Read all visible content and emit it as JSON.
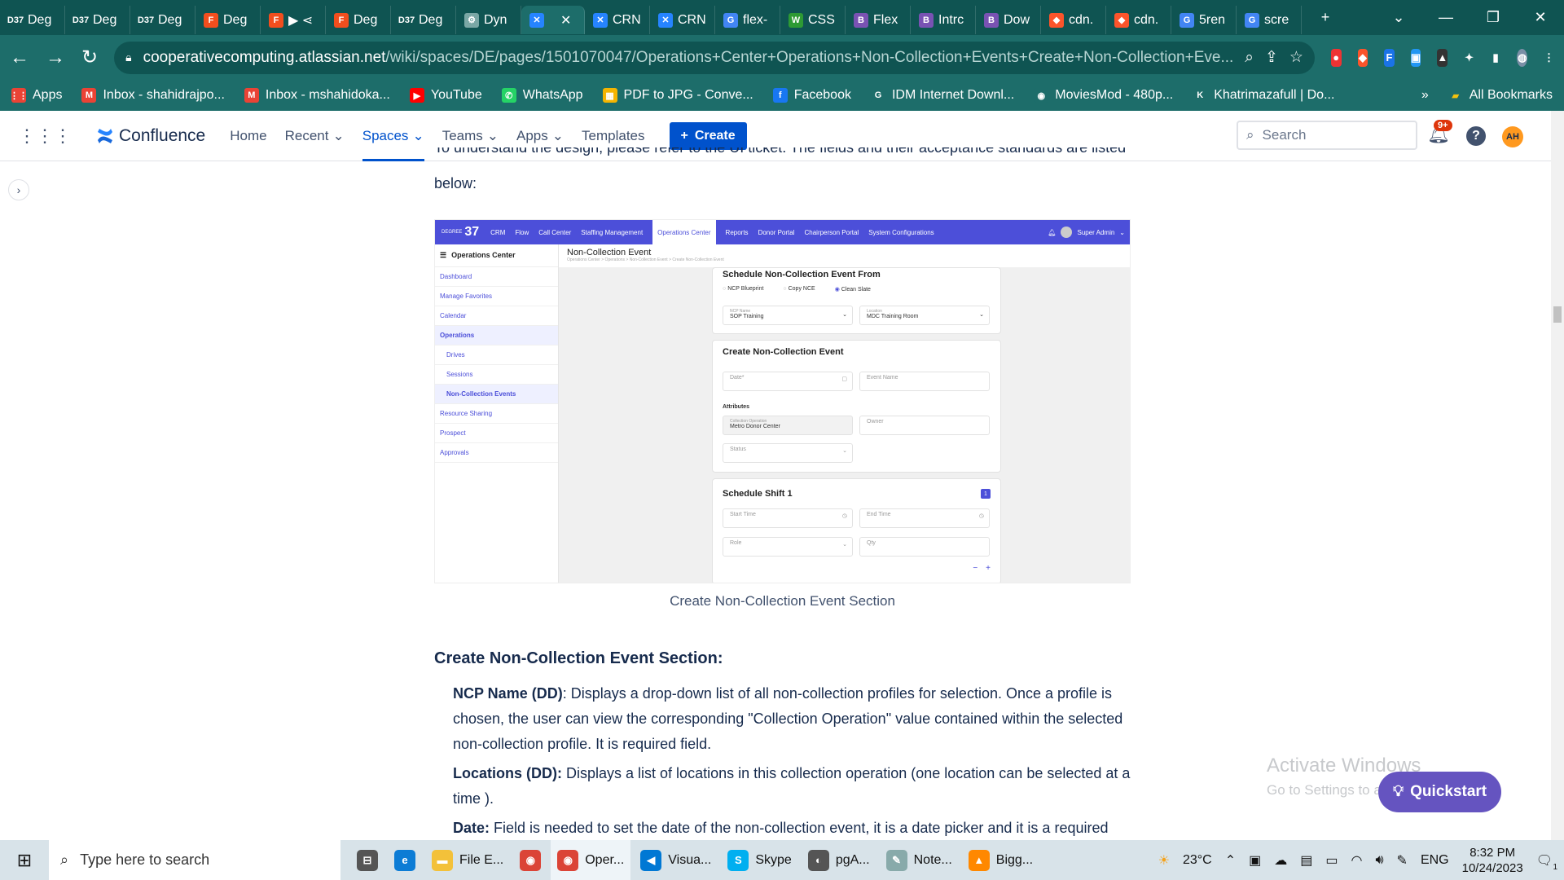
{
  "browser": {
    "tabs": [
      {
        "label": "Deg",
        "icon": "D37",
        "color": "#0f5452"
      },
      {
        "label": "Deg",
        "icon": "D37",
        "color": "#0f5452"
      },
      {
        "label": "Deg",
        "icon": "D37",
        "color": "#0f5452"
      },
      {
        "label": "Deg",
        "icon": "F",
        "color": "#f24e1e"
      },
      {
        "label": "▶ ⋖",
        "icon": "F",
        "color": "#f24e1e"
      },
      {
        "label": "Deg",
        "icon": "F",
        "color": "#f24e1e"
      },
      {
        "label": "Deg",
        "icon": "D37",
        "color": "#0f5452"
      },
      {
        "label": "Dyn",
        "icon": "⚙",
        "color": "#7aa7a5"
      },
      {
        "label": "✕",
        "icon": "✕",
        "color": "#2684ff",
        "active": true
      },
      {
        "label": "CRN",
        "icon": "✕",
        "color": "#2684ff"
      },
      {
        "label": "CRN",
        "icon": "✕",
        "color": "#2684ff"
      },
      {
        "label": "flex-",
        "icon": "G",
        "color": "#4285f4"
      },
      {
        "label": "CSS",
        "icon": "W",
        "color": "#2d9a34"
      },
      {
        "label": "Flex",
        "icon": "B",
        "color": "#7952b3"
      },
      {
        "label": "Intrc",
        "icon": "B",
        "color": "#7952b3"
      },
      {
        "label": "Dow",
        "icon": "B",
        "color": "#7952b3"
      },
      {
        "label": "cdn.",
        "icon": "◆",
        "color": "#fb542b"
      },
      {
        "label": "cdn.",
        "icon": "◆",
        "color": "#fb542b"
      },
      {
        "label": "5ren",
        "icon": "G",
        "color": "#4285f4"
      },
      {
        "label": "scre",
        "icon": "G",
        "color": "#4285f4"
      }
    ],
    "url_host": "cooperativecomputing.atlassian.net",
    "url_path": "/wiki/spaces/DE/pages/1501070047/Operations+Center+Operations+Non-Collection+Events+Create+Non-Collection+Eve...",
    "bookmarks": [
      {
        "label": "Apps",
        "icon": "⋮⋮",
        "color": "#ea4335"
      },
      {
        "label": "Inbox - shahidrajpo...",
        "icon": "M",
        "color": "#ea4335"
      },
      {
        "label": "Inbox - mshahidoka...",
        "icon": "M",
        "color": "#ea4335"
      },
      {
        "label": "YouTube",
        "icon": "▶",
        "color": "#ff0000"
      },
      {
        "label": "WhatsApp",
        "icon": "✆",
        "color": "#25d366"
      },
      {
        "label": "PDF to JPG - Conve...",
        "icon": "▦",
        "color": "#f4b400"
      },
      {
        "label": "Facebook",
        "icon": "f",
        "color": "#1877f2"
      },
      {
        "label": "IDM Internet Downl...",
        "icon": "G",
        "color": "#1d6d6a"
      },
      {
        "label": "MoviesMod - 480p...",
        "icon": "◉",
        "color": "#1d6d6a"
      },
      {
        "label": "Khatrimazafull | Do...",
        "icon": "K",
        "color": "#1d6d6a"
      }
    ],
    "bookmarks_more": "»",
    "all_bookmarks": "All Bookmarks"
  },
  "confluence": {
    "brand": "Confluence",
    "nav": [
      {
        "label": "Home",
        "dropdown": false
      },
      {
        "label": "Recent",
        "dropdown": true
      },
      {
        "label": "Spaces",
        "dropdown": true,
        "selected": true
      },
      {
        "label": "Teams",
        "dropdown": true
      },
      {
        "label": "Apps",
        "dropdown": true
      },
      {
        "label": "Templates",
        "dropdown": false
      }
    ],
    "create_label": "Create",
    "search_placeholder": "Search",
    "notif_badge": "9+",
    "avatar": "AH"
  },
  "content": {
    "intro_cut": "To understand the design, please refer to the UI ticket. The fields and their acceptance standards are listed",
    "intro_end": "below:",
    "caption": "Create Non-Collection Event Section",
    "heading": "Create Non-Collection Event Section:",
    "list": [
      {
        "term": "NCP Name (DD)",
        "sep": ": ",
        "text": "Displays a drop-down list of all non-collection profiles for selection. Once a profile is chosen, the user can view the corresponding \"Collection Operation\" value contained within the selected non-collection profile. It is required field."
      },
      {
        "term": "Locations (DD):",
        "sep": " ",
        "text": "Displays a list of locations in this collection operation (one location can be selected at a time )."
      },
      {
        "term": "Date:",
        "sep": " ",
        "text": "Field is needed to set the date of the non-collection event, it is a date picker and it is a required"
      }
    ]
  },
  "embedded": {
    "logo_small": "DEGREE",
    "logo_num": "37",
    "topnav": [
      "CRM",
      "Flow",
      "Call Center",
      "Staffing Management",
      "Operations Center",
      "Reports",
      "Donor Portal",
      "Chairperson Portal",
      "System Configurations"
    ],
    "active_nav": "Operations Center",
    "user": "Super Admin",
    "side_title": "Operations Center",
    "side_items": [
      "Dashboard",
      "Manage Favorites",
      "Calendar",
      "Operations",
      "Drives",
      "Sessions",
      "Non-Collection Events",
      "Resource Sharing",
      "Prospect",
      "Approvals"
    ],
    "page_title": "Non-Collection Event",
    "breadcrumb": "Operations Center  >  Operations  >  Non-Collection Event  >  Create Non-Collection Event",
    "schedule_from_title": "Schedule Non-Collection Event From",
    "radios": [
      "NCP Blueprint",
      "Copy NCE",
      "Clean Slate"
    ],
    "ncp_name_label": "NCP Name",
    "ncp_name_value": "SOP Training",
    "location_label": "Location",
    "location_value": "MDC Training Room",
    "create_title": "Create Non-Collection Event",
    "date_placeholder": "Date*",
    "event_name_placeholder": "Event Name",
    "attributes_label": "Attributes",
    "collection_op_label": "Collection Operation",
    "collection_op_value": "Metro Donor Center",
    "owner_placeholder": "Owner",
    "status_placeholder": "Status",
    "shift_title": "Schedule Shift 1",
    "shift_badge": "1",
    "start_time": "Start Time",
    "end_time": "End Time",
    "role": "Role",
    "qty": "Qty",
    "minus": "−",
    "plus": "+"
  },
  "windows": {
    "activate_title": "Activate Windows",
    "activate_sub": "Go to Settings to activate Windows.",
    "quickstart": "Quickstart",
    "search_placeholder": "Type here to search",
    "apps": [
      {
        "label": "",
        "icon": "⊟",
        "color": "#555"
      },
      {
        "label": "",
        "icon": "e",
        "color": "#0c7cd5"
      },
      {
        "label": "File E...",
        "icon": "▬",
        "color": "#f3c13a"
      },
      {
        "label": "",
        "icon": "◉",
        "color": "#db4437"
      },
      {
        "label": "Oper...",
        "icon": "◉",
        "color": "#db4437"
      },
      {
        "label": "Visua...",
        "icon": "◀",
        "color": "#0078d4"
      },
      {
        "label": "Skype",
        "icon": "S",
        "color": "#00aff0"
      },
      {
        "label": "pgA...",
        "icon": "◐",
        "color": "#555"
      },
      {
        "label": "Note...",
        "icon": "✎",
        "color": "#8aa"
      },
      {
        "label": "Bigg...",
        "icon": "▲",
        "color": "#ff8800"
      }
    ],
    "temperature": "23°C",
    "lang": "ENG",
    "time": "8:32 PM",
    "date": "10/24/2023",
    "notif_count": "1"
  }
}
